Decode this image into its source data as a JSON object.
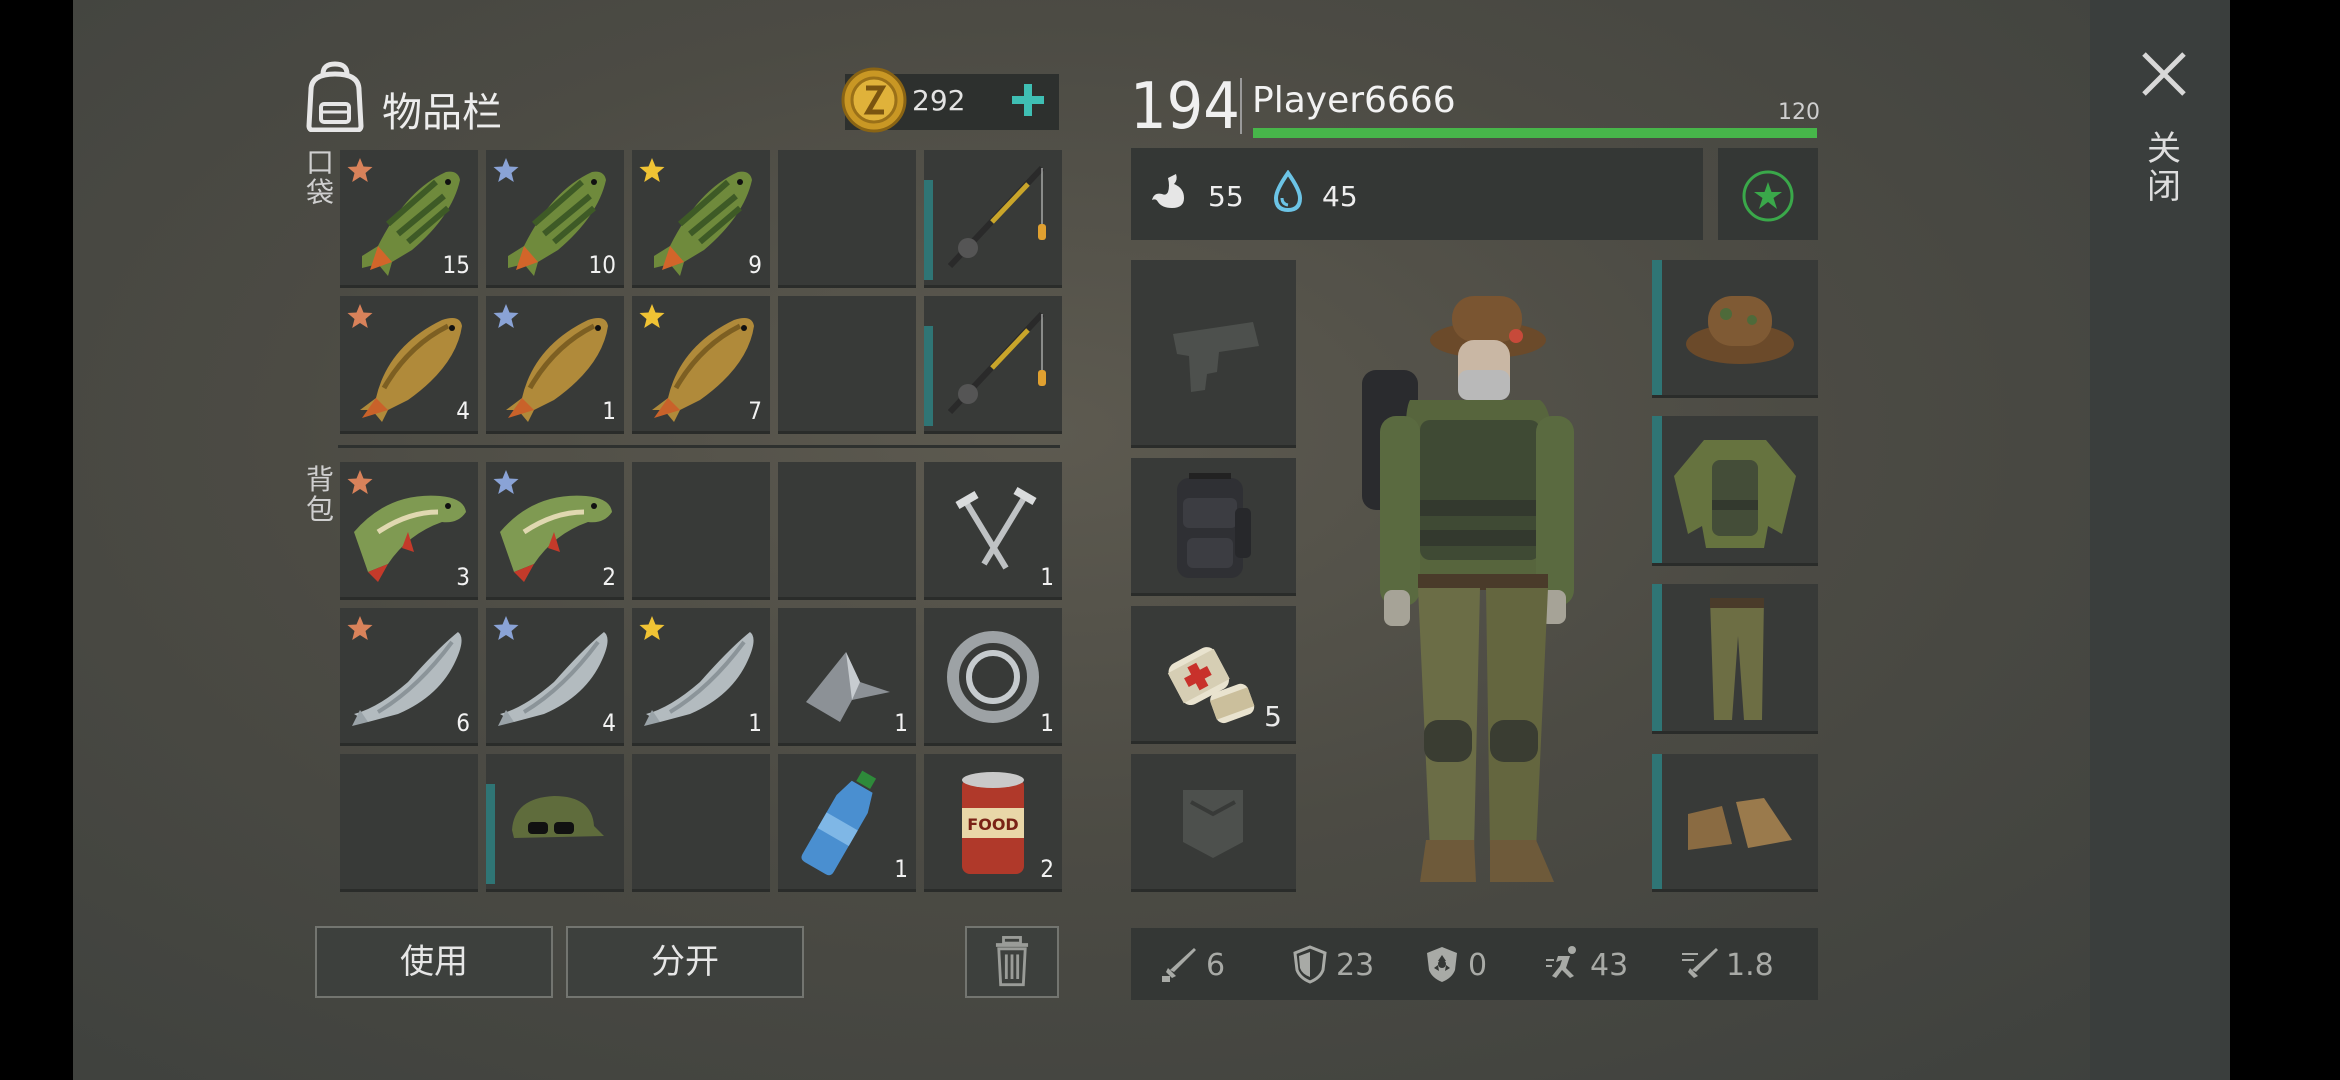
{
  "inventory": {
    "title": "物品栏",
    "coins": "292",
    "pocket_label": "口袋",
    "backpack_label": "背包",
    "pocket_slots": [
      {
        "item": "perch",
        "tier": "bronze",
        "count": "15"
      },
      {
        "item": "perch",
        "tier": "silver",
        "count": "10"
      },
      {
        "item": "perch",
        "tier": "gold",
        "count": "9"
      },
      {
        "item": "empty",
        "tier": "",
        "count": ""
      },
      {
        "item": "fishing-rod",
        "tier": "",
        "count": ""
      },
      {
        "item": "carp",
        "tier": "bronze",
        "count": "4"
      },
      {
        "item": "carp",
        "tier": "silver",
        "count": "1"
      },
      {
        "item": "carp",
        "tier": "gold",
        "count": "7"
      },
      {
        "item": "empty",
        "tier": "",
        "count": ""
      },
      {
        "item": "fishing-rod",
        "tier": "",
        "count": ""
      }
    ],
    "backpack_slots": [
      {
        "item": "pike",
        "tier": "bronze",
        "count": "3"
      },
      {
        "item": "pike",
        "tier": "silver",
        "count": "2"
      },
      {
        "item": "empty",
        "tier": "",
        "count": ""
      },
      {
        "item": "empty",
        "tier": "",
        "count": ""
      },
      {
        "item": "nails",
        "tier": "",
        "count": "1"
      },
      {
        "item": "salmon",
        "tier": "bronze",
        "count": "6"
      },
      {
        "item": "salmon",
        "tier": "silver",
        "count": "4"
      },
      {
        "item": "salmon",
        "tier": "gold",
        "count": "1"
      },
      {
        "item": "scrap-metal",
        "tier": "",
        "count": "1"
      },
      {
        "item": "bearing",
        "tier": "",
        "count": "1"
      },
      {
        "item": "empty",
        "tier": "",
        "count": ""
      },
      {
        "item": "camo-cap",
        "tier": "",
        "count": ""
      },
      {
        "item": "empty",
        "tier": "",
        "count": ""
      },
      {
        "item": "water-bottle",
        "tier": "",
        "count": "1"
      },
      {
        "item": "canned-food",
        "tier": "",
        "count": "2"
      }
    ],
    "use_label": "使用",
    "split_label": "分开"
  },
  "character": {
    "level": "194",
    "name": "Player6666",
    "xp_max": "120",
    "xp_progress": 1.0,
    "hunger": "55",
    "thirst": "45",
    "bandage_count": "5",
    "combat_stats": {
      "attack": "6",
      "defense": "23",
      "radiation": "0",
      "speed": "43",
      "attack_speed": "1.8"
    }
  },
  "close_label": "关闭",
  "colors": {
    "accent_teal": "#2f7575",
    "xp_green": "#47b64a",
    "plus_teal": "#3fbfb4",
    "fav_green": "#3aa84a"
  }
}
